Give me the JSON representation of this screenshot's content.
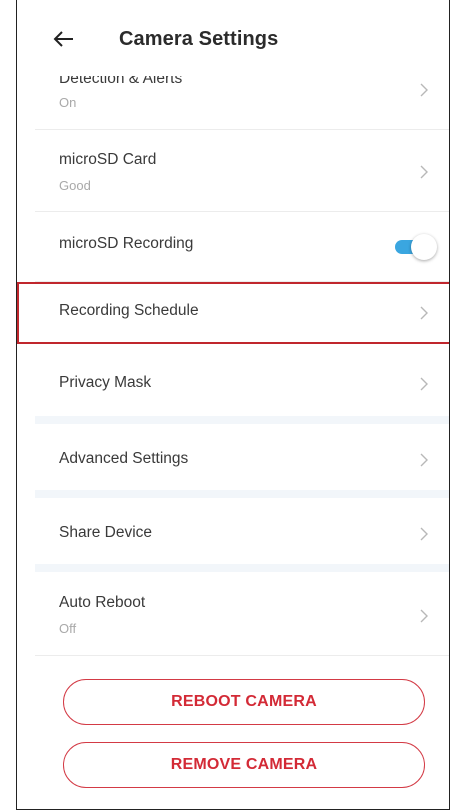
{
  "header": {
    "title": "Camera Settings",
    "back_icon": "arrow-left-icon"
  },
  "settings": {
    "detection": {
      "label": "Detection & Alerts",
      "value": "On"
    },
    "microsd_card": {
      "label": "microSD Card",
      "value": "Good"
    },
    "microsd_recording": {
      "label": "microSD Recording",
      "enabled": true
    },
    "recording_schedule": {
      "label": "Recording Schedule"
    },
    "privacy_mask": {
      "label": "Privacy Mask"
    },
    "advanced_settings": {
      "label": "Advanced Settings"
    },
    "share_device": {
      "label": "Share Device"
    },
    "auto_reboot": {
      "label": "Auto Reboot",
      "value": "Off"
    }
  },
  "actions": {
    "reboot_label": "REBOOT CAMERA",
    "remove_label": "REMOVE CAMERA"
  },
  "colors": {
    "accent": "#3aa6e0",
    "danger": "#d32a36",
    "highlight": "#c0262d",
    "section_bg": "#f2f6fa"
  }
}
